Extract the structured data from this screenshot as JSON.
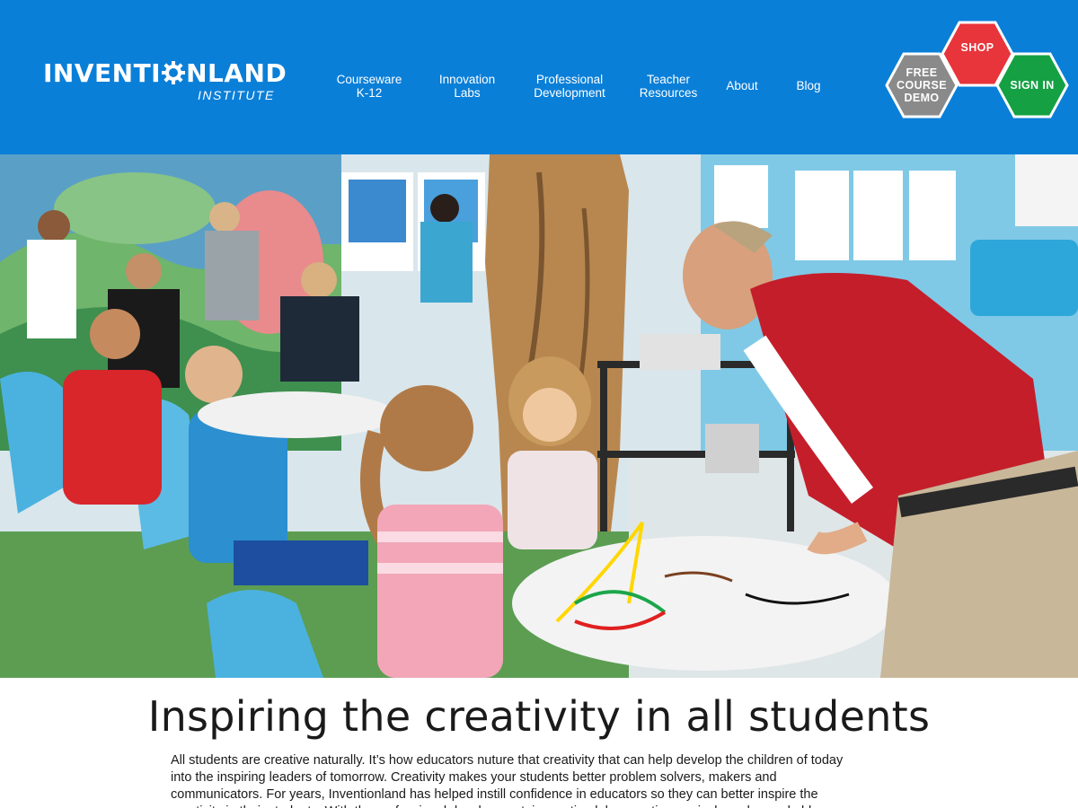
{
  "brand": {
    "logo_word_left": "INVENTI",
    "logo_word_right": "NLAND",
    "logo_sub": "INSTITUTE",
    "header_color": "#0a7fd8"
  },
  "nav": {
    "items": [
      {
        "line1": "Courseware",
        "line2": "K-12"
      },
      {
        "line1": "Innovation",
        "line2": "Labs"
      },
      {
        "line1": "Professional",
        "line2": "Development"
      },
      {
        "line1": "Teacher",
        "line2": "Resources"
      },
      {
        "line1": "About",
        "line2": ""
      },
      {
        "line1": "Blog",
        "line2": ""
      }
    ]
  },
  "cta": {
    "demo": {
      "line1": "FREE",
      "line2": "COURSE",
      "line3": "DEMO",
      "color": "#8a8a8a"
    },
    "shop": {
      "label": "SHOP",
      "color": "#e8343b"
    },
    "signin": {
      "label": "SIGN IN",
      "color": "#14a043"
    }
  },
  "hero": {
    "icon": "classroom-photo"
  },
  "content": {
    "headline": "Inspiring the creativity in all students",
    "body": "All students are creative naturally. It’s how educators nuture that creativity that can help develop the children of today into the inspiring leaders of tomorrow. Creativity makes your students better problem solvers, makers and communicators. For years, Inventionland has helped instill confidence in educators so they can better inspire the creativity in their students. With the professional development, innovation labs, creative curricula and remarkable"
  }
}
